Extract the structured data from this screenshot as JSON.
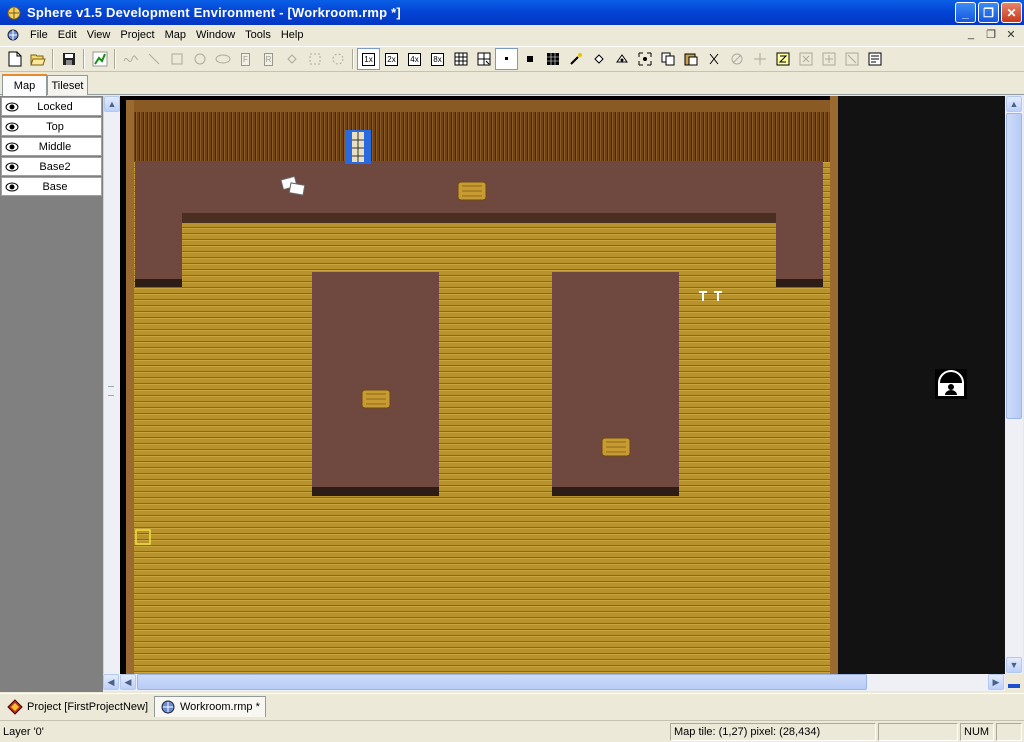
{
  "window": {
    "title": "Sphere v1.5 Development Environment - [Workroom.rmp *]",
    "minimize": "_",
    "maximize": "❐",
    "close": "✕"
  },
  "menu": {
    "items": [
      "File",
      "Edit",
      "View",
      "Project",
      "Map",
      "Window",
      "Tools",
      "Help"
    ],
    "mdi_minimize": "_",
    "mdi_restore": "❐",
    "mdi_close": "✕"
  },
  "toolbar": {
    "zoom_1x": "1x",
    "zoom_2x": "2x",
    "zoom_4x": "4x",
    "zoom_8x": "8x",
    "fill_rect_label": "F",
    "fill_area_label": "R",
    "disabled_tools": [
      "curve-tool",
      "line-tool",
      "rectangle-tool",
      "circle-tool",
      "ellipse-tool",
      "fill-rectangle-tool",
      "fill-area-tool",
      "fill-tool",
      "select-tool",
      "lasso-tool"
    ]
  },
  "sidebar": {
    "tabs": [
      "Map",
      "Tileset"
    ],
    "active_tab": "Map",
    "layers": [
      {
        "name": "Locked",
        "visible": true
      },
      {
        "name": "Top",
        "visible": true
      },
      {
        "name": "Middle",
        "visible": true
      },
      {
        "name": "Base2",
        "visible": true
      },
      {
        "name": "Base",
        "visible": true
      }
    ]
  },
  "document_tabs": [
    {
      "label": "Project [FirstProjectNew]",
      "active": false
    },
    {
      "label": "Workroom.rmp *",
      "active": true
    }
  ],
  "status": {
    "layer": "Layer '0'",
    "position": "Map tile: (1,27) pixel: (28,434)",
    "num": "NUM"
  },
  "colors": {
    "titlebar": "#0445d6",
    "floor": "#b8922c",
    "table": "#6f4840",
    "wall": "#7a4a1e",
    "map_void": "#121212"
  }
}
